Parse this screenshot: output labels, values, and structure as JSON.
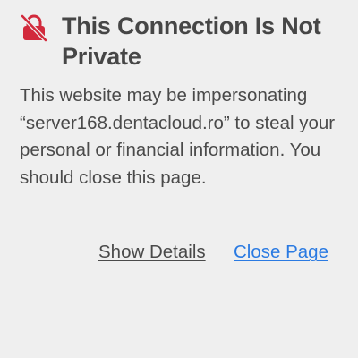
{
  "colors": {
    "background": "#efefef",
    "icon": "#d22a3c",
    "text": "#4a4a4a",
    "link_primary": "#2a7ae2"
  },
  "warning": {
    "icon": "broken-lock-icon",
    "title": "This Connection Is Not Private",
    "message": "This website may be impersonating “server168.dentacloud.ro” to steal your personal or financial information. You should close this page."
  },
  "actions": {
    "show_details_label": "Show Details",
    "close_page_label": "Close Page"
  }
}
